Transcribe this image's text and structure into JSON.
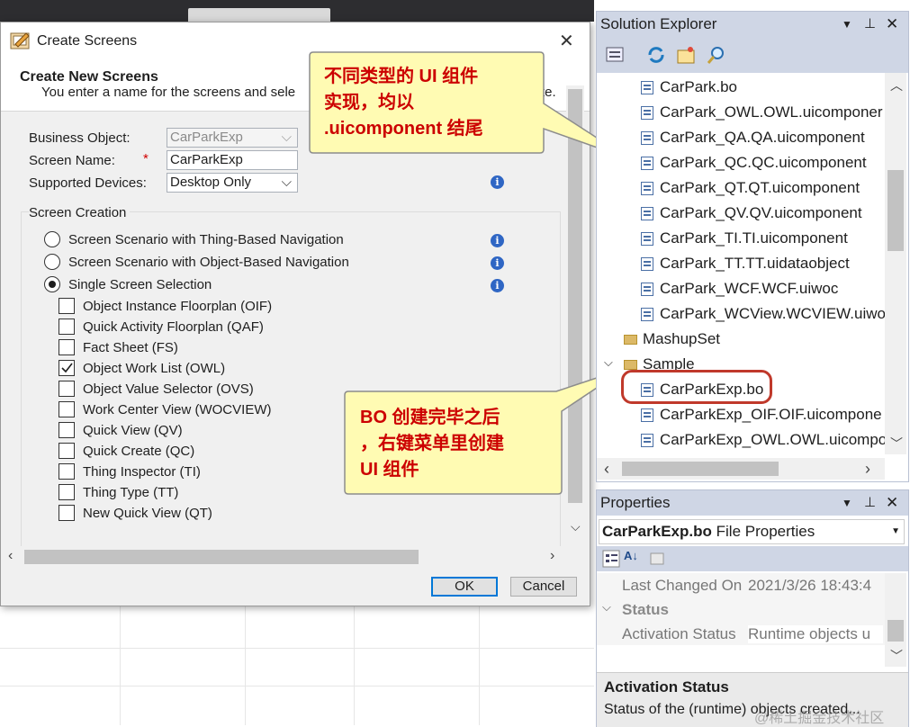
{
  "dialog": {
    "title": "Create Screens",
    "close_glyph": "✕",
    "header_title": "Create New Screens",
    "header_subtitle": "You enter a name for the screens and sele",
    "header_subtitle_tail": "te.",
    "fields": {
      "business_object_label": "Business Object:",
      "business_object_value": "CarParkExp",
      "screen_name_label": "Screen Name:",
      "required_mark": "*",
      "screen_name_value": "CarParkExp",
      "supported_devices_label": "Supported Devices:",
      "supported_devices_value": "Desktop Only"
    },
    "section_title": "Screen Creation",
    "radios": [
      {
        "label": "Screen Scenario with Thing-Based Navigation",
        "selected": false
      },
      {
        "label": "Screen Scenario with Object-Based Navigation",
        "selected": false
      },
      {
        "label": "Single Screen Selection",
        "selected": true
      }
    ],
    "checkboxes": [
      {
        "label": "Object Instance Floorplan (OIF)",
        "checked": false
      },
      {
        "label": "Quick Activity Floorplan (QAF)",
        "checked": false
      },
      {
        "label": "Fact Sheet (FS)",
        "checked": false
      },
      {
        "label": "Object Work List (OWL)",
        "checked": true
      },
      {
        "label": "Object Value Selector (OVS)",
        "checked": false
      },
      {
        "label": "Work Center View (WOCVIEW)",
        "checked": false
      },
      {
        "label": "Quick View (QV)",
        "checked": false
      },
      {
        "label": "Quick Create (QC)",
        "checked": false
      },
      {
        "label": "Thing Inspector (TI)",
        "checked": false
      },
      {
        "label": "Thing Type (TT)",
        "checked": false
      },
      {
        "label": "New Quick View (QT)",
        "checked": false
      }
    ],
    "ok_label": "OK",
    "cancel_label": "Cancel"
  },
  "callouts": {
    "top": [
      "不同类型的 UI 组件",
      "实现，均以",
      ".uicomponent 结尾"
    ],
    "bottom": [
      "BO 创建完毕之后",
      "，右键菜单里创建",
      "UI 组件"
    ],
    "fill": "#fffbb3",
    "stroke": "#8c8c8c",
    "text_color": "#cc0000"
  },
  "solution_explorer": {
    "title": "Solution Explorer",
    "items": [
      {
        "label": "CarPark.bo",
        "type": "file"
      },
      {
        "label": "CarPark_OWL.OWL.uicomponer",
        "type": "file"
      },
      {
        "label": "CarPark_QA.QA.uicomponent",
        "type": "file"
      },
      {
        "label": "CarPark_QC.QC.uicomponent",
        "type": "file"
      },
      {
        "label": "CarPark_QT.QT.uicomponent",
        "type": "file"
      },
      {
        "label": "CarPark_QV.QV.uicomponent",
        "type": "file"
      },
      {
        "label": "CarPark_TI.TI.uicomponent",
        "type": "file"
      },
      {
        "label": "CarPark_TT.TT.uidataobject",
        "type": "file"
      },
      {
        "label": "CarPark_WCF.WCF.uiwoc",
        "type": "file"
      },
      {
        "label": "CarPark_WCView.WCVIEW.uiwo",
        "type": "file"
      },
      {
        "label": "MashupSet",
        "type": "folder"
      },
      {
        "label": "Sample",
        "type": "folder"
      },
      {
        "label": "CarParkExp.bo",
        "type": "file"
      },
      {
        "label": "CarParkExp_OIF.OIF.uicompone",
        "type": "file"
      },
      {
        "label": "CarParkExp_OWL.OWL.uicompo",
        "type": "file"
      }
    ],
    "highlight_color": "#c0392b"
  },
  "properties": {
    "title": "Properties",
    "object_name": "CarParkExp.bo",
    "object_suffix": "File Properties",
    "last_changed_label": "Last Changed On",
    "last_changed_value": "2021/3/26 18:43:4",
    "status_group": "Status",
    "activation_label": "Activation Status",
    "activation_value": "Runtime objects u",
    "desc_title": "Activation Status",
    "desc_text": "Status of the (runtime) objects created..."
  },
  "watermark": "@稀土掘金技术社区"
}
